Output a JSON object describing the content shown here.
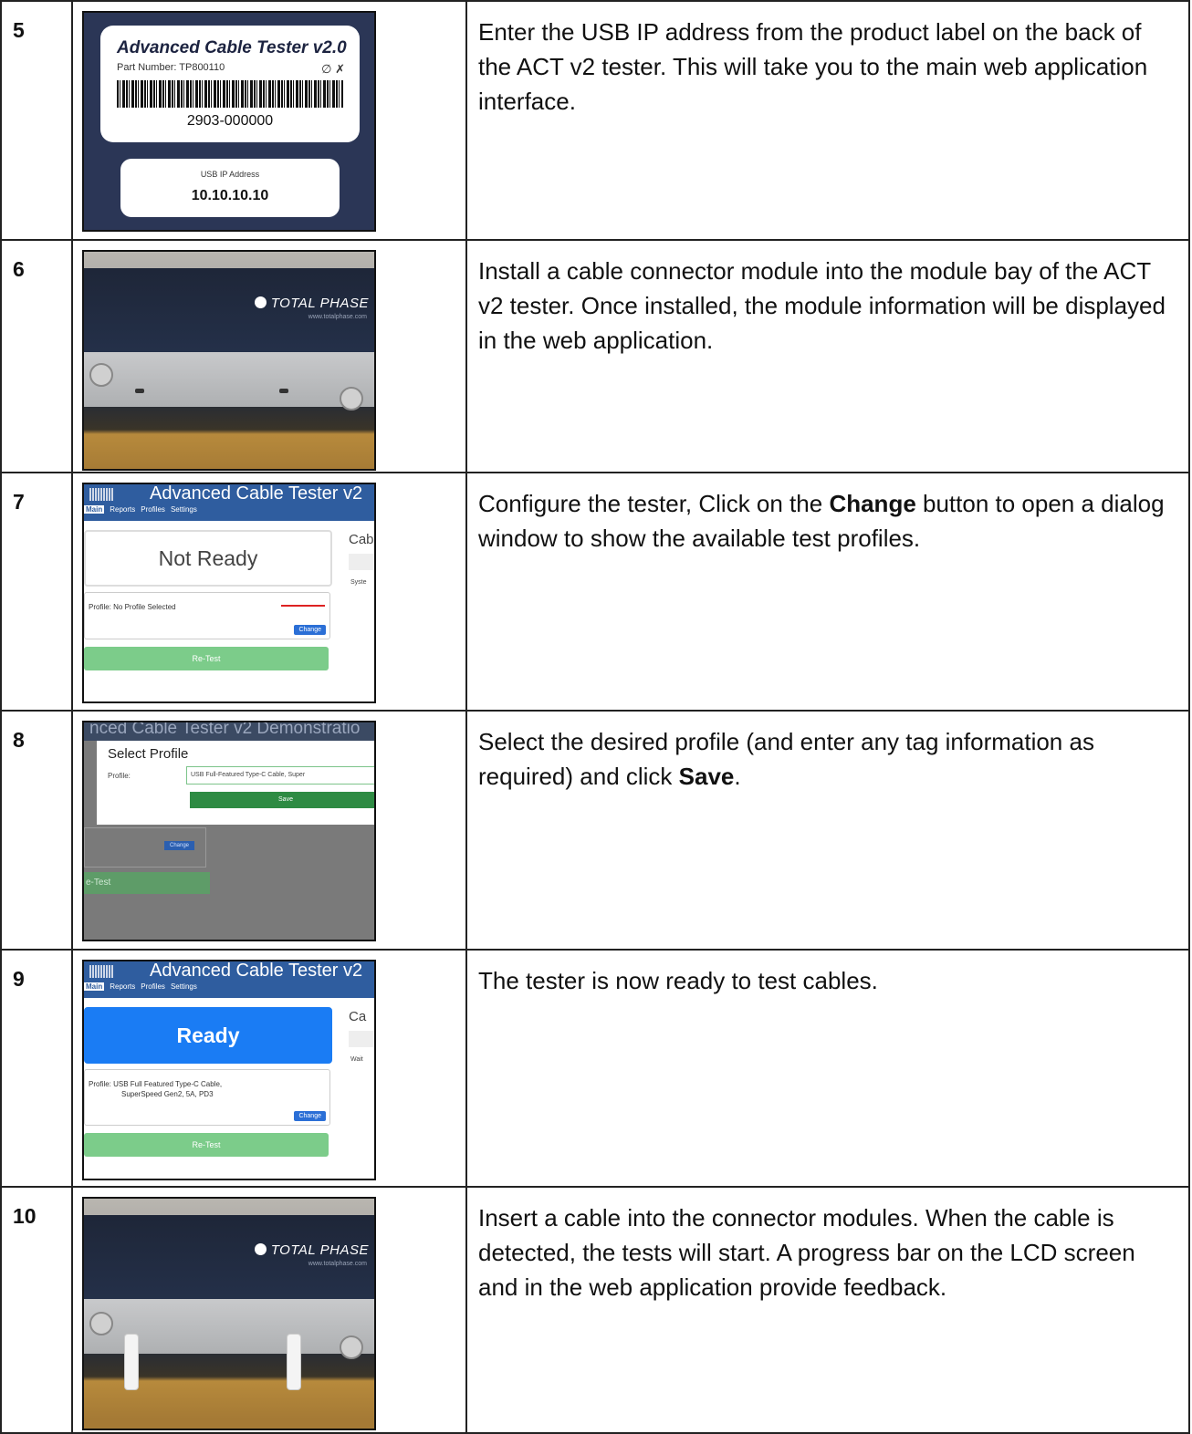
{
  "rows": [
    {
      "step": "5",
      "description": "Enter the USB IP address from the product label on the back of the ACT v2 tester. This will take you to the main web application interface.",
      "image": {
        "title": "Advanced Cable Tester v2.0",
        "part_number": "Part Number:  TP800110",
        "icons": "∅ ✗",
        "serial": "2903-000000",
        "ip_caption": "USB IP Address",
        "ip_value": "10.10.10.10"
      }
    },
    {
      "step": "6",
      "description": "Install a cable connector module into the module bay of the ACT v2 tester. Once installed, the module information will be displayed in the web application.",
      "image": {
        "logo": "TOTAL PHASE",
        "logo_sub": "www.totalphase.com"
      }
    },
    {
      "step": "7",
      "description_pre": "Configure the tester, Click on the ",
      "description_bold": "Change",
      "description_post": " button to open a dialog window to show the available test profiles.",
      "image": {
        "app_title": "Advanced Cable Tester v2",
        "nav": [
          "Main",
          "Reports",
          "Profiles",
          "Settings"
        ],
        "status": "Not Ready",
        "side_label": "Cab",
        "side_small": "Syste",
        "profile_text": "Profile:   No Profile Selected",
        "change": "Change",
        "retest": "Re-Test"
      }
    },
    {
      "step": "8",
      "description_pre": "Select the desired profile (and enter any tag information as required) and click ",
      "description_bold": "Save",
      "description_post": ".",
      "image": {
        "bg_title": "nced Cable Tester v2 Demonstratio",
        "dialog_title": "Select Profile",
        "profile_label": "Profile:",
        "profile_value": "USB Full-Featured Type-C Cable, Super",
        "save": "Save",
        "change": "Change",
        "retest": "e-Test"
      }
    },
    {
      "step": "9",
      "description": "The tester is now ready to test cables.",
      "image": {
        "app_title": "Advanced Cable Tester v2",
        "nav": [
          "Main",
          "Reports",
          "Profiles",
          "Settings"
        ],
        "status": "Ready",
        "side_label": "Ca",
        "side_small": "Wait",
        "profile_text_1": "Profile:   USB Full Featured Type-C Cable,",
        "profile_text_2": "SuperSpeed Gen2, 5A, PD3",
        "change": "Change",
        "retest": "Re-Test"
      }
    },
    {
      "step": "10",
      "description": "Insert a cable into the connector modules. When the cable is detected, the tests will start. A progress bar on the LCD screen and in the web application provide feedback.",
      "image": {
        "logo": "TOTAL PHASE",
        "logo_sub": "www.totalphase.com"
      }
    }
  ]
}
